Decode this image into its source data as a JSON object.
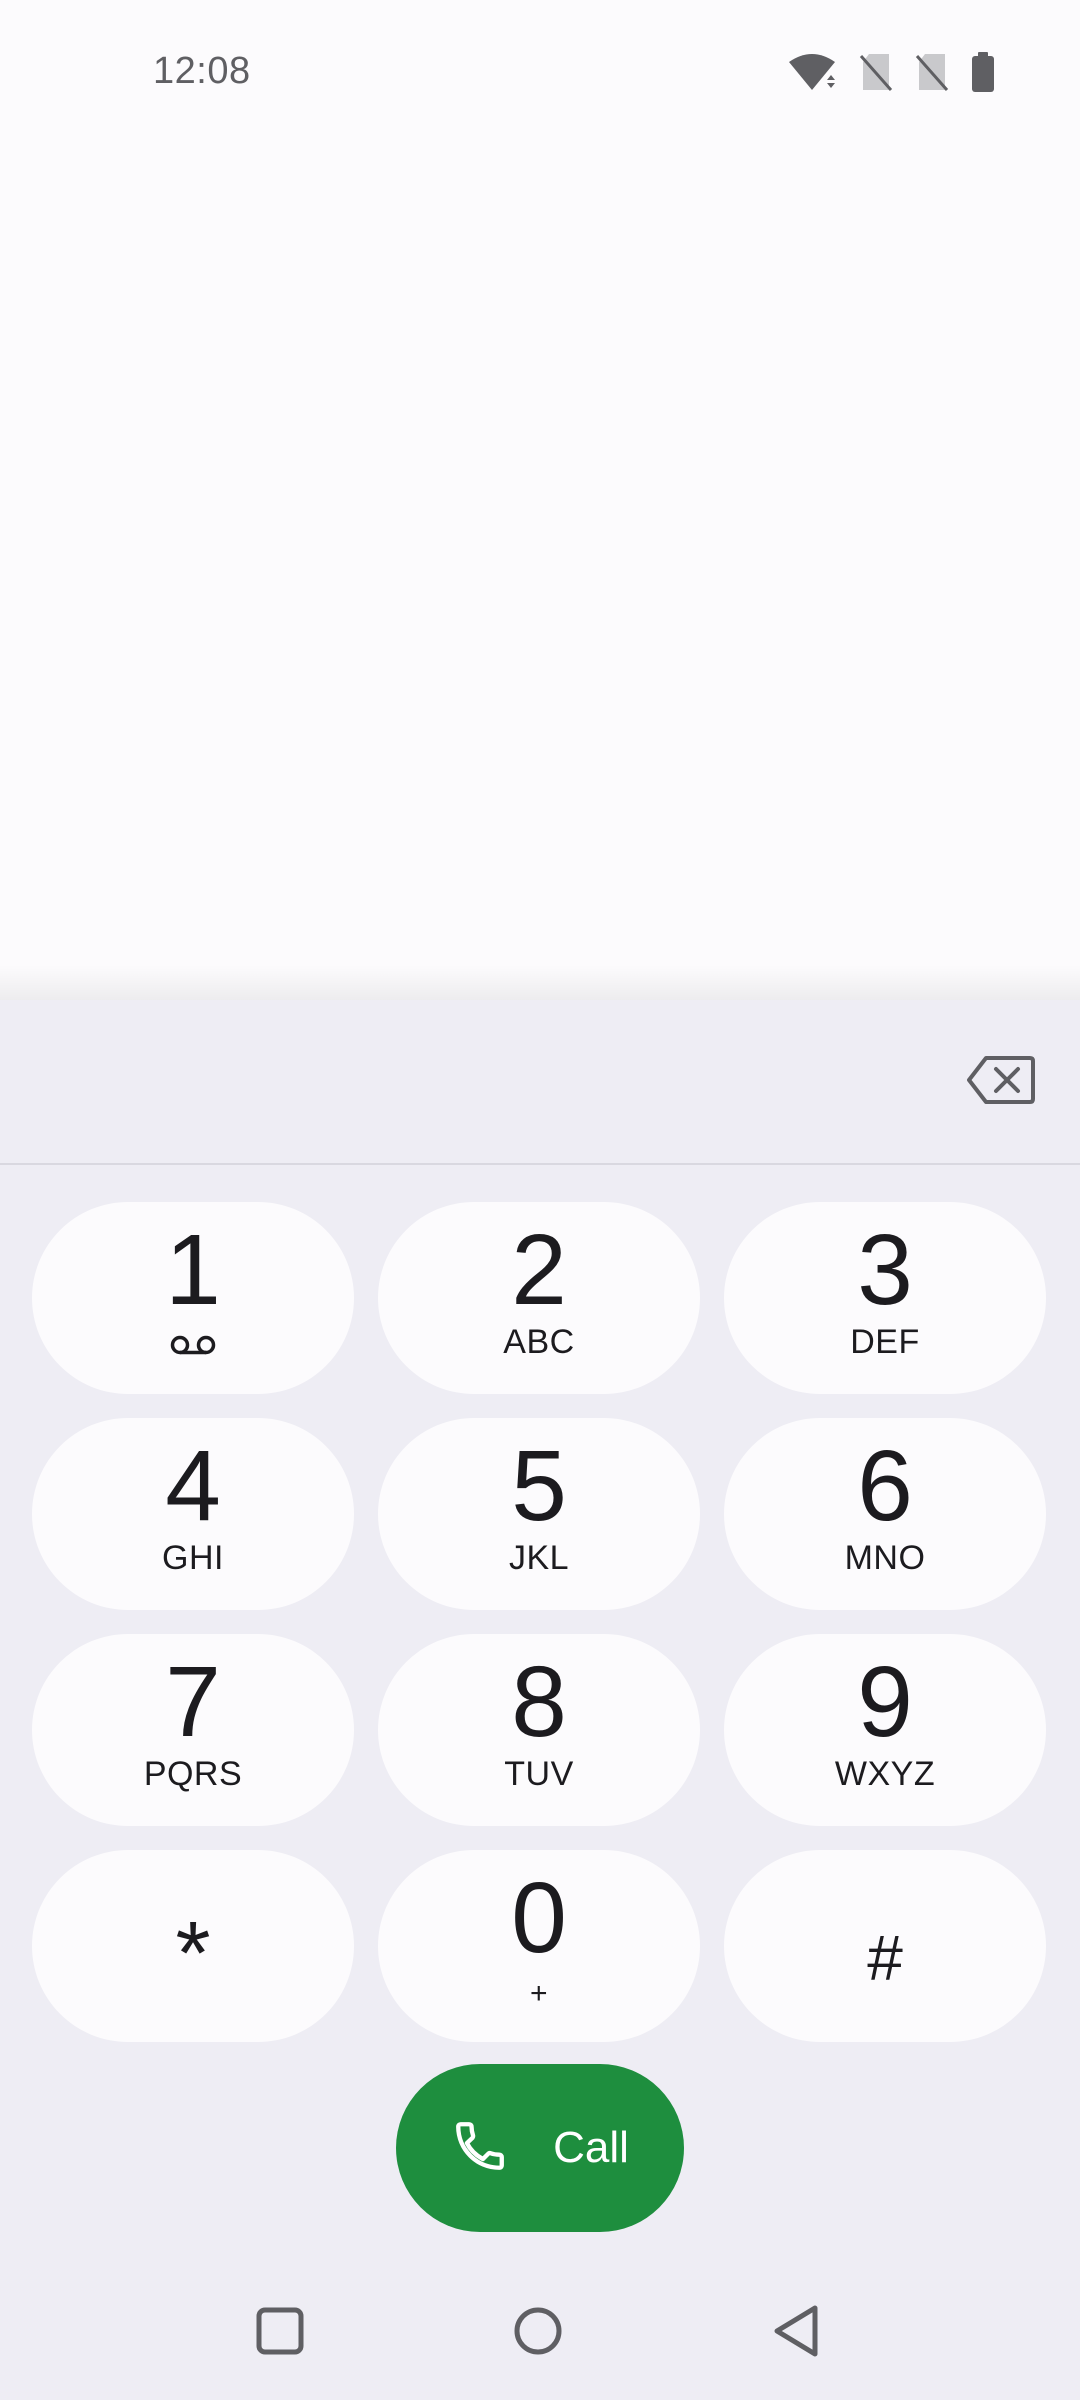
{
  "status_bar": {
    "time": "12:08",
    "icons": [
      "wifi-icon",
      "sim-off-icon",
      "sim-off-icon",
      "battery-icon"
    ]
  },
  "dialpad": {
    "digits": "",
    "keys": [
      {
        "digit": "1",
        "letters": "",
        "sub_icon": "voicemail-icon"
      },
      {
        "digit": "2",
        "letters": "ABC"
      },
      {
        "digit": "3",
        "letters": "DEF"
      },
      {
        "digit": "4",
        "letters": "GHI"
      },
      {
        "digit": "5",
        "letters": "JKL"
      },
      {
        "digit": "6",
        "letters": "MNO"
      },
      {
        "digit": "7",
        "letters": "PQRS"
      },
      {
        "digit": "8",
        "letters": "TUV"
      },
      {
        "digit": "9",
        "letters": "WXYZ"
      },
      {
        "digit": "*",
        "letters": ""
      },
      {
        "digit": "0",
        "letters": "+"
      },
      {
        "digit": "#",
        "letters": ""
      }
    ],
    "call_label": "Call",
    "call_color": "#1e8e3e"
  },
  "nav_bar": {
    "icons": [
      "recents-icon",
      "home-icon",
      "back-icon"
    ]
  }
}
